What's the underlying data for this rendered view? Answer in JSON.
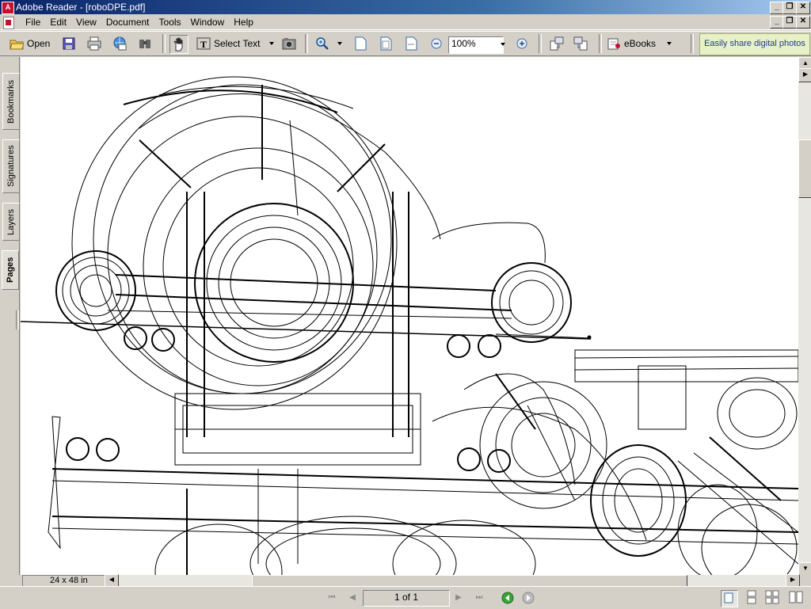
{
  "window": {
    "title": "Adobe Reader - [roboDPE.pdf]",
    "app_icon_text": "A"
  },
  "menu": {
    "items": [
      "File",
      "Edit",
      "View",
      "Document",
      "Tools",
      "Window",
      "Help"
    ]
  },
  "toolbar": {
    "open_label": "Open",
    "select_text_label": "Select Text",
    "zoom_value": "100%",
    "ebooks_label": "eBooks",
    "promo_label": "Easily share digital photos"
  },
  "left_tabs": {
    "bookmarks": "Bookmarks",
    "signatures": "Signatures",
    "layers": "Layers",
    "pages": "Pages"
  },
  "status": {
    "page_size": "24 x 48 in",
    "page_indicator": "1 of 1"
  },
  "icons": {
    "first_page": "first-page-icon",
    "prev_page": "previous-page-icon",
    "next_page": "next-page-icon",
    "last_page": "last-page-icon",
    "go_back": "go-back-icon",
    "go_forward": "go-forward-icon"
  },
  "colors": {
    "titlebar_start": "#0a246a",
    "titlebar_end": "#a6caf0",
    "chrome": "#d4d0c8",
    "promo_bg": "#e8f0c8",
    "promo_text": "#1f3c88"
  }
}
